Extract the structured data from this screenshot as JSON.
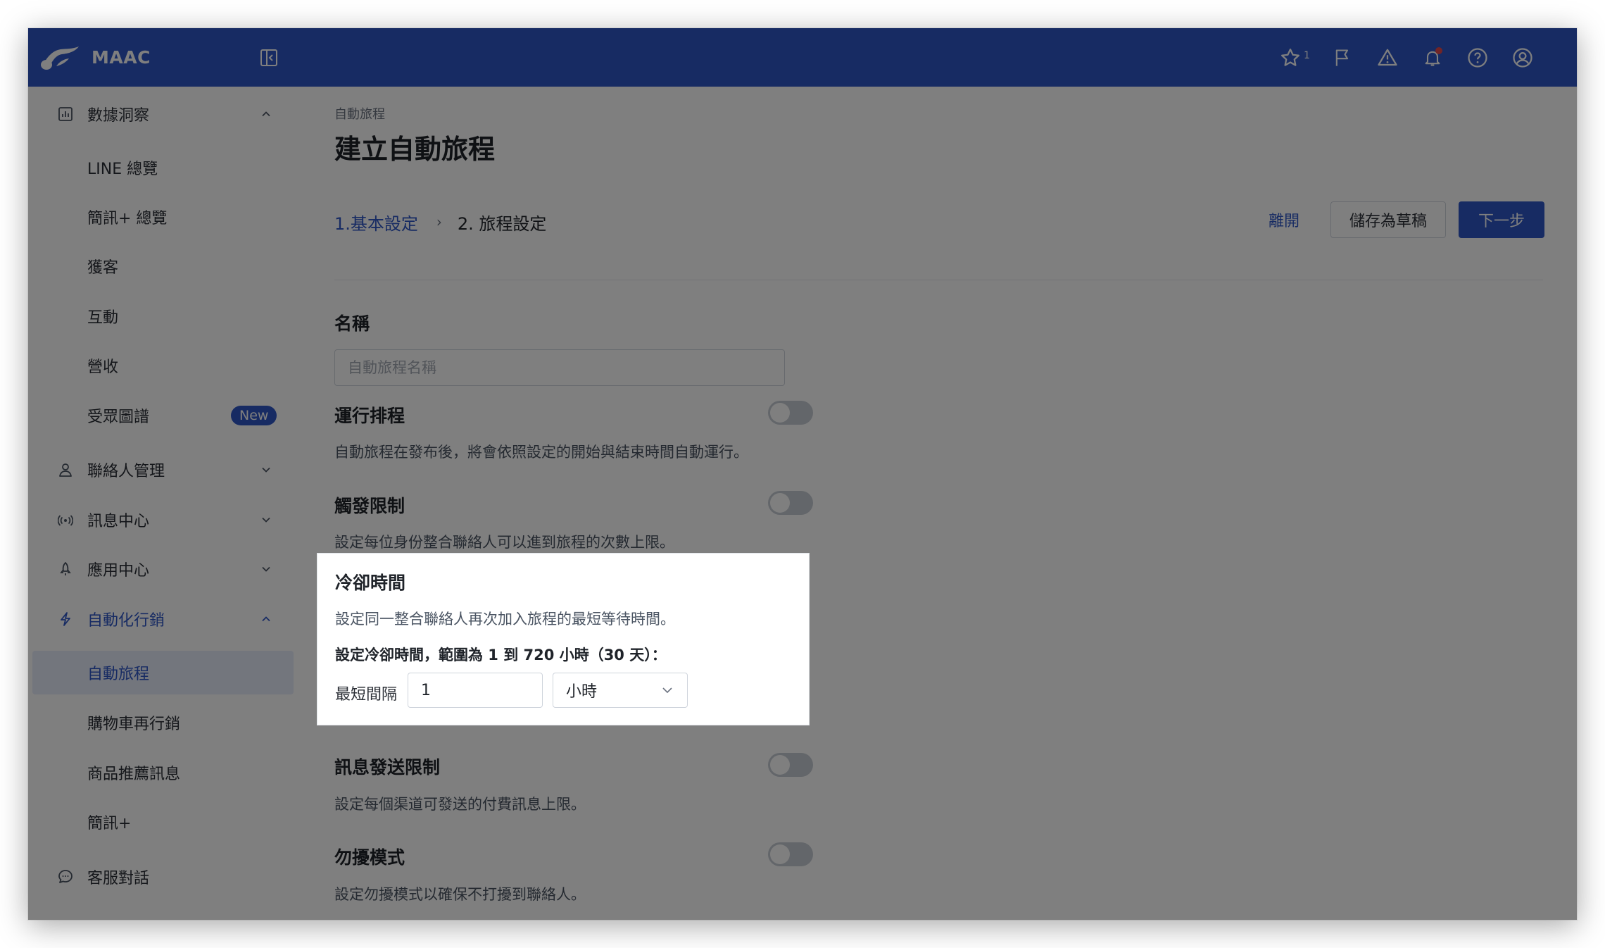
{
  "topbar": {
    "brand": "MAAC",
    "favorites_count": "1",
    "icons": [
      "star-icon",
      "flag-icon",
      "warning-icon",
      "bell-icon",
      "help-icon",
      "user-icon"
    ]
  },
  "sidebar": {
    "analytics": {
      "label": "數據洞察",
      "items": [
        "LINE 總覽",
        "簡訊+ 總覽",
        "獲客",
        "互動",
        "營收",
        "受眾圖譜"
      ],
      "new_badge": "New"
    },
    "contacts": "聯絡人管理",
    "messages": "訊息中心",
    "apps": "應用中心",
    "automation": {
      "label": "自動化行銷",
      "items": [
        "自動旅程",
        "購物車再行銷",
        "商品推薦訊息",
        "簡訊+"
      ]
    },
    "chat": "客服對話"
  },
  "main": {
    "breadcrumb": "自動旅程",
    "title": "建立自動旅程",
    "step1": "1.基本設定",
    "step_sep": "›",
    "step2": "2. 旅程設定",
    "leave_label": "離開",
    "draft_label": "儲存為草稿",
    "next_label": "下一步",
    "name": {
      "title": "名稱",
      "placeholder": "自動旅程名稱"
    },
    "schedule": {
      "title": "運行排程",
      "desc": "自動旅程在發布後，將會依照設定的開始與結束時間自動運行。",
      "enabled": false
    },
    "trigger_limit": {
      "title": "觸發限制",
      "desc": "設定每位身份整合聯絡人可以進到旅程的次數上限。",
      "enabled": false
    },
    "cooldown": {
      "title": "冷卻時間",
      "desc": "設定同一整合聯絡人再次加入旅程的最短等待時間。",
      "rule": "設定冷卻時間，範圍為 1 到 720 小時（30 天）：",
      "min_label": "最短間隔",
      "value": "1",
      "unit": "小時"
    },
    "message_limit": {
      "title": "訊息發送限制",
      "desc": "設定每個渠道可發送的付費訊息上限。",
      "enabled": false
    },
    "dnd": {
      "title": "勿擾模式",
      "desc": "設定勿擾模式以確保不打擾到聯絡人。",
      "enabled": false
    }
  },
  "colors": {
    "brand_blue": "#2e56c7",
    "overlay": "rgba(0,0,0,0.5)"
  }
}
